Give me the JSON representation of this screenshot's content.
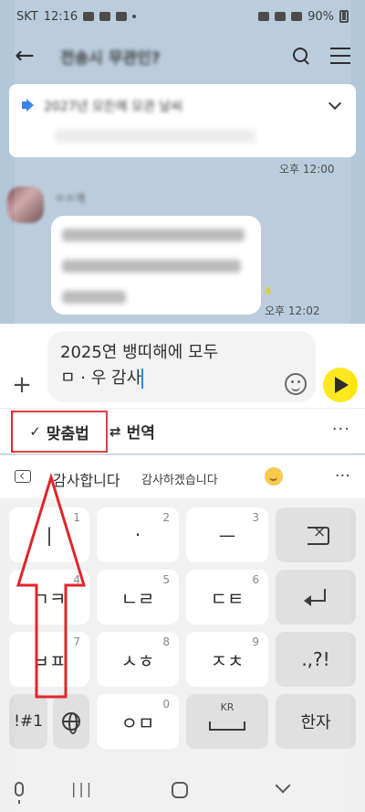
{
  "status": {
    "carrier": "SKT",
    "time": "12:16",
    "battery": "90%"
  },
  "header": {
    "title": "전송시 무관인?"
  },
  "notice": {
    "text": "2027년 모든에 모관 날씨"
  },
  "messages": [
    {
      "time": "오후 12:00"
    },
    {
      "sender": "ㅇㅇ개",
      "unread": "4",
      "time": "오후 12:02"
    }
  ],
  "composer": {
    "text": "2025연 뱅띠해에 모두\nㅁ · 우 감사"
  },
  "toolbar": {
    "spell_label": "맞춤법",
    "translate_label": "번역",
    "more": "···"
  },
  "suggestions": {
    "items": [
      "감사합니다",
      "감사하겠습니다"
    ],
    "more": "···"
  },
  "keyboard": {
    "rows": [
      [
        {
          "label": "|",
          "sub": "1"
        },
        {
          "label": "·",
          "sub": "2"
        },
        {
          "label": "ㅡ",
          "sub": "3"
        }
      ],
      [
        {
          "label": "ㄱㅋ",
          "sub": "4"
        },
        {
          "label": "ㄴㄹ",
          "sub": "5"
        },
        {
          "label": "ㄷㅌ",
          "sub": "6"
        }
      ],
      [
        {
          "label": "ㅂㅍ",
          "sub": "7"
        },
        {
          "label": "ㅅㅎ",
          "sub": "8"
        },
        {
          "label": "ㅈㅊ",
          "sub": "9"
        },
        {
          "label": ".,?!"
        }
      ],
      [
        {
          "label": "!#1"
        },
        {
          "label": "ㅇㅁ",
          "sub": "0"
        },
        {
          "label": "KR"
        },
        {
          "label": "한자"
        }
      ]
    ]
  },
  "colors": {
    "chat_bg": "#b2c7d9",
    "send": "#fee500",
    "highlight": "#e0262c",
    "accent": "#1e73e8"
  }
}
